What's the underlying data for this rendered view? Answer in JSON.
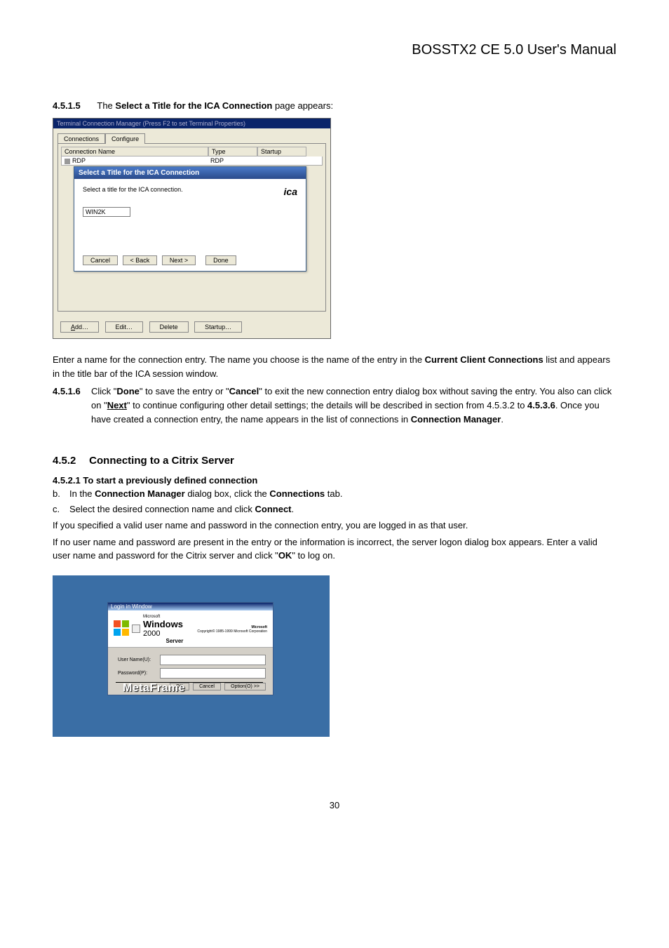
{
  "header": {
    "title": "BOSSTX2 CE 5.0 User's Manual"
  },
  "section_4515": {
    "num": "4.5.1.5",
    "text_pre": "The ",
    "text_bold": "Select a Title for the ICA Connection",
    "text_post": " page appears:"
  },
  "ss1": {
    "titlebar": "Terminal Connection Manager (Press F2 to set Terminal Properties)",
    "tab1": "Connections",
    "tab2": "Configure",
    "col_name": "Connection Name",
    "col_type": "Type",
    "col_startup": "Startup",
    "row_name": "RDP",
    "row_type": "RDP",
    "wiz_title": "Select a Title for the ICA Connection",
    "wiz_instruct": "Select a title for the ICA connection.",
    "wiz_value": "WIN2K",
    "ica_logo": "ica",
    "btn_cancel": "Cancel",
    "btn_back": "< Back",
    "btn_next": "Next >",
    "btn_done": "Done",
    "bottom_add": "Add…",
    "bottom_edit": "Edit…",
    "bottom_delete": "Delete",
    "bottom_startup": "Startup…"
  },
  "para_enter": {
    "p1a": "Enter a name for the connection entry. The name you choose is the name of the entry in the ",
    "p1b": "Current Client Connections",
    "p1c": " list and appears in the title bar of the ICA session window."
  },
  "section_4516": {
    "num": "4.5.1.6",
    "t1": "Click \"",
    "t2": "Done",
    "t3": "\" to save the entry or \"",
    "t4": "Cancel",
    "t5": "\" to exit the new connection entry dialog box without saving the entry. You also can click on \"",
    "t6": "Next",
    "t7": "\" to continue configuring other detail settings; the details will be described in section from 4.5.3.2 to ",
    "t8": "4.5.3.6",
    "t9": ". Once you have created a connection entry, the name appears in the list of connections in ",
    "t10": "Connection Manager",
    "t11": "."
  },
  "section_452": {
    "num": "4.5.2",
    "title": "Connecting to a Citrix Server"
  },
  "section_4521": {
    "title": "4.5.2.1  To start a previously defined connection",
    "b_letter": "b.",
    "b_t1": "In the ",
    "b_t2": "Connection Manager",
    "b_t3": " dialog box, click the ",
    "b_t4": "Connections",
    "b_t5": " tab.",
    "c_letter": "c.",
    "c_t1": "Select the desired connection name and click ",
    "c_t2": "Connect",
    "c_t3": "."
  },
  "para_valid": "If you specified a valid user name and password in the connection entry, you are logged in as that user.",
  "para_nouser": {
    "t1": "If no user name and password are present in the entry or the information is incorrect, the server logon dialog box appears. Enter a valid user name and password for the Citrix server and click \"",
    "t2": "OK",
    "t3": "\" to log on."
  },
  "ss2": {
    "dlg_title": "Login in Window",
    "ms_top": "Microsoft",
    "copyright": "Copyright© 1985-1999\nMicrosoft Corporation",
    "brand_ms": "Microsoft",
    "brand_win": "Windows",
    "brand_yr": " 2000",
    "brand_srv": "Server",
    "lbl_user": "User Name(U):",
    "lbl_pass": "Password(P):",
    "btn_ok": "OK",
    "btn_cancel": "Cancel",
    "btn_option": "Option(O) >>",
    "metaframe": "MetaFrame"
  },
  "page_number": "30"
}
